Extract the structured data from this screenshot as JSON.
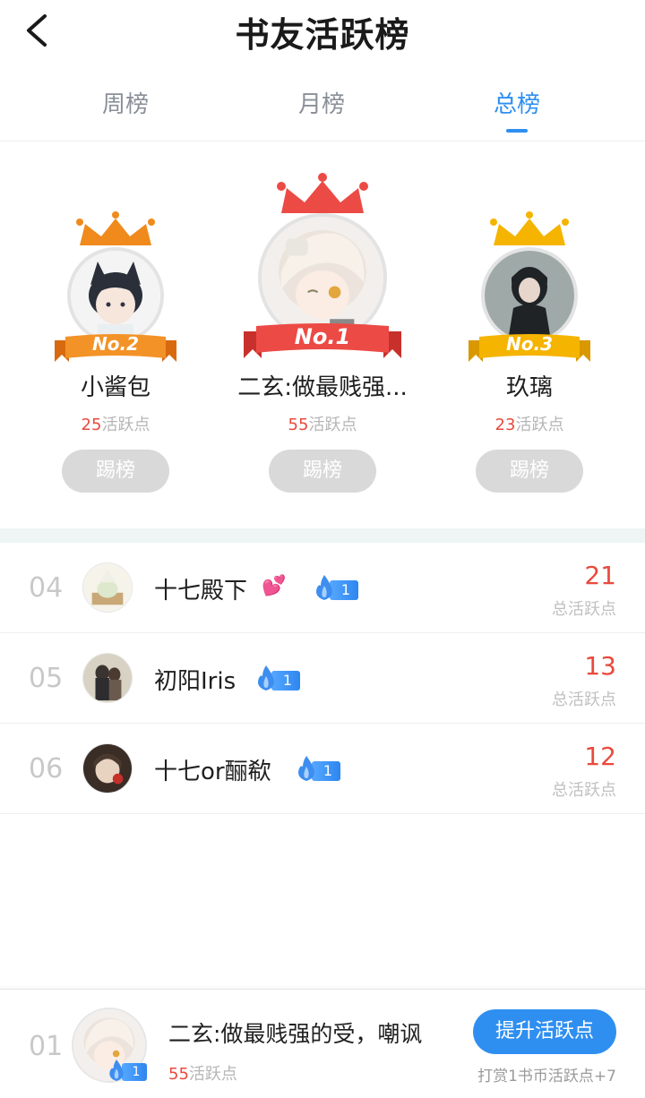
{
  "header": {
    "title": "书友活跃榜"
  },
  "tabs": [
    {
      "label": "周榜",
      "active": false
    },
    {
      "label": "月榜",
      "active": false
    },
    {
      "label": "总榜",
      "active": true
    }
  ],
  "podium": {
    "first": {
      "rank_label": "No.1",
      "name": "二玄:做最贱强...",
      "points": "55",
      "points_unit": "活跃点",
      "kick_label": "踢榜"
    },
    "second": {
      "rank_label": "No.2",
      "name": "小酱包",
      "points": "25",
      "points_unit": "活跃点",
      "kick_label": "踢榜"
    },
    "third": {
      "rank_label": "No.3",
      "name": "玖璃",
      "points": "23",
      "points_unit": "活跃点",
      "kick_label": "踢榜"
    }
  },
  "ranking": [
    {
      "rank": "04",
      "name": "十七殿下",
      "has_heart": true,
      "level": "1",
      "score": "21",
      "score_label": "总活跃点"
    },
    {
      "rank": "05",
      "name": "初阳Iris",
      "has_heart": false,
      "level": "1",
      "score": "13",
      "score_label": "总活跃点"
    },
    {
      "rank": "06",
      "name": "十七or酾欷",
      "has_heart": false,
      "level": "1",
      "score": "12",
      "score_label": "总活跃点"
    }
  ],
  "me": {
    "rank": "01",
    "name": "二玄:做最贱强的受，嘲讽",
    "level": "1",
    "points": "55",
    "points_unit": "活跃点",
    "boost_label": "提升活跃点",
    "reward_hint": "打赏1书币活跃点+7"
  },
  "colors": {
    "accent": "#2f8ff0",
    "score_red": "#e84a3d",
    "gold": "#f5b400",
    "orange": "#f08a1c",
    "crimson": "#ec4a45"
  },
  "icons": [
    "back-arrow-icon",
    "crown-icon",
    "flame-icon",
    "heart-icon"
  ]
}
